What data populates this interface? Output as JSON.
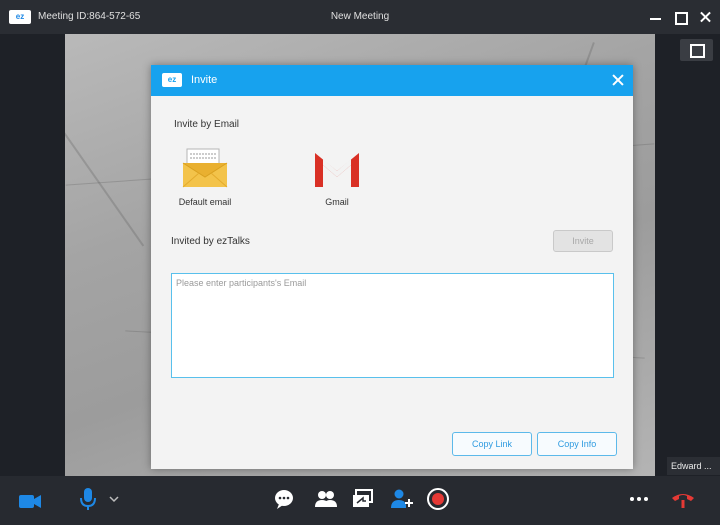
{
  "window": {
    "meeting_id": "Meeting ID:864-572-65",
    "title": "New Meeting",
    "logo_text": "ez"
  },
  "video": {
    "participant_name": "Edward ..."
  },
  "dialog": {
    "title": "Invite",
    "logo_text": "ez",
    "invite_by_email_label": "Invite by Email",
    "options": [
      {
        "label": "Default email",
        "icon": "envelope-icon"
      },
      {
        "label": "Gmail",
        "icon": "gmail-icon"
      }
    ],
    "invited_by_label": "Invited by ezTalks",
    "invite_button": "Invite",
    "email_placeholder": "Please enter participants's Email",
    "copy_link_button": "Copy Link",
    "copy_info_button": "Copy Info"
  },
  "colors": {
    "accent": "#17a2ee",
    "toolbar_bg": "#272a30",
    "titlebar_bg": "#2a2d33",
    "record_red": "#e53935",
    "hangup_red": "#e53935"
  },
  "toolbar": {
    "icons": [
      "video-camera-icon",
      "microphone-icon",
      "chevron-down-icon",
      "chat-icon",
      "participants-icon",
      "share-screen-icon",
      "invite-icon",
      "record-icon",
      "more-icon",
      "hang-up-icon"
    ]
  }
}
